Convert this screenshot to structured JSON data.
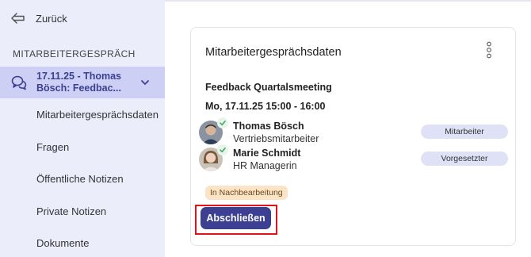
{
  "sidebar": {
    "back_label": "Zurück",
    "section_title": "MITARBEITERGESPRÄCH",
    "active_item": {
      "line1": "17.11.25 - Thomas",
      "line2": "Bösch: Feedbac..."
    },
    "items": [
      {
        "label": "Mitarbeitergesprächsdaten"
      },
      {
        "label": "Fragen"
      },
      {
        "label": "Öffentliche Notizen"
      },
      {
        "label": "Private Notizen"
      },
      {
        "label": "Dokumente"
      }
    ]
  },
  "card": {
    "title": "Mitarbeitergesprächsdaten",
    "meeting_name": "Feedback Quartalsmeeting",
    "meeting_date": "Mo, 17.11.25 15:00 - 16:00",
    "participants": [
      {
        "name": "Thomas Bösch",
        "position": "Vertriebsmitarbeiter",
        "role": "Mitarbeiter"
      },
      {
        "name": "Marie Schmidt",
        "position": "HR Managerin",
        "role": "Vorgesetzter"
      }
    ],
    "status": "In Nachbearbeitung",
    "finish_button": "Abschließen"
  },
  "colors": {
    "sidebar_bg": "#ecedfb",
    "active_item_bg": "#cdd0f4",
    "primary_button": "#3d3f92",
    "status_badge_bg": "#fbe3c6",
    "role_badge_bg": "#dfe1f6",
    "highlight_border": "#e0131b",
    "check_green": "#3fae5e"
  },
  "icons": {
    "back": "arrow-left-icon",
    "active_item": "chat-bubbles-icon",
    "expand": "chevron-down-icon",
    "menu": "kebab-menu-icon",
    "participant_status": "check-icon"
  }
}
